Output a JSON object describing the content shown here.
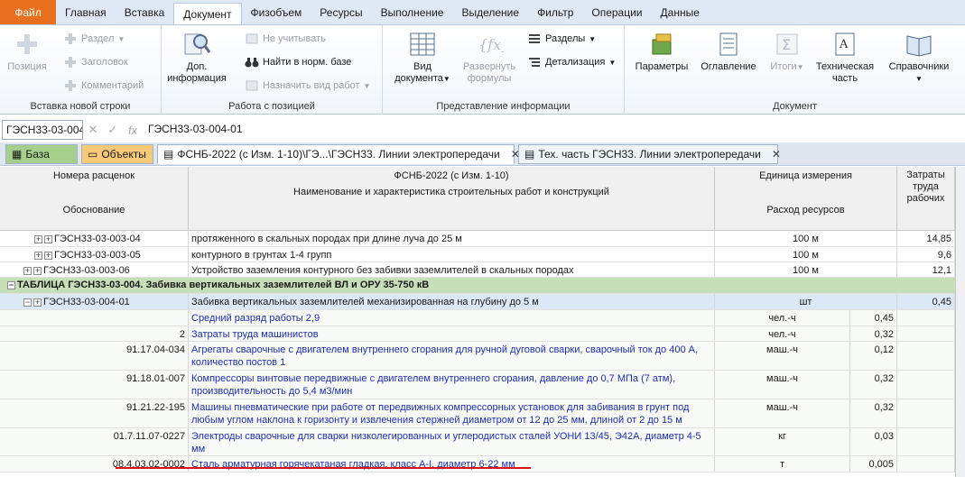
{
  "menu": {
    "file": "Файл",
    "items": [
      "Главная",
      "Вставка",
      "Документ",
      "Физобъем",
      "Ресурсы",
      "Выполнение",
      "Выделение",
      "Фильтр",
      "Операции",
      "Данные"
    ],
    "active_index": 2
  },
  "ribbon": {
    "insert_group": {
      "title": "Вставка новой строки",
      "position": "Позиция",
      "section": "Раздел",
      "heading": "Заголовок",
      "comment": "Комментарий"
    },
    "position_group": {
      "title": "Работа с позицией",
      "dop_info_1": "Доп.",
      "dop_info_2": "информация",
      "ignore": "Не учитывать",
      "find_norm": "Найти в норм. базе",
      "assign_work": "Назначить вид работ"
    },
    "view_group": {
      "title": "Представление информации",
      "doc_view_1": "Вид",
      "doc_view_2": "документа",
      "expand_1": "Развернуть",
      "expand_2": "формулы",
      "sections": "Разделы",
      "detail": "Детализация"
    },
    "document_group": {
      "title": "Документ",
      "params": "Параметры",
      "toc": "Оглавление",
      "totals": "Итоги",
      "tech_1": "Техническая",
      "tech_2": "часть",
      "refs": "Справочники"
    }
  },
  "formula_bar": {
    "cell_ref": "ГЭСН33-03-004",
    "fx": "fx",
    "value": "ГЭСН33-03-004-01"
  },
  "tabs": {
    "base": "База",
    "objects": "Объекты",
    "doc": "ФСНБ-2022 (с Изм. 1-10)\\ГЭ...\\ГЭСН33. Линии электропередачи",
    "tech": "Тех. часть ГЭСН33. Линии электропередачи"
  },
  "header": {
    "col1_top": "Номера расценок",
    "col1_bottom": "Обоснование",
    "col2_top": "ФСНБ-2022 (с Изм. 1-10)",
    "col2_mid": "Наименование и характеристика строительных работ и конструкций",
    "col3_top": "Единица измерения",
    "col3_bottom": "Расход ресурсов",
    "col4_1": "Затраты",
    "col4_2": "труда",
    "col4_3": "рабочих"
  },
  "rows": [
    {
      "code": "ГЭСН33-03-003-04",
      "name": "протяженного в скальных породах при длине луча до 25 м",
      "unit": "100 м",
      "value": "14,85"
    },
    {
      "code": "ГЭСН33-03-003-05",
      "name": "контурного в грунтах 1-4 групп",
      "unit": "100 м",
      "value": "9,6"
    },
    {
      "code": "ГЭСН33-03-003-06",
      "name": "Устройство заземления контурного без забивки заземлителей в скальных породах",
      "unit": "100 м",
      "value": "12,1"
    }
  ],
  "section": {
    "title": "ТАБЛИЦА ГЭСН33-03-004. Забивка вертикальных заземлителей ВЛ и ОРУ 35-750 кВ"
  },
  "selected_row": {
    "code": "ГЭСН33-03-004-01",
    "name": "Забивка вертикальных заземлителей механизированная на глубину до 5 м",
    "unit": "шт",
    "value": "0,45"
  },
  "resources": [
    {
      "code": "",
      "name": "Средний разряд работы 2,9",
      "unit": "чел.-ч",
      "qty": "0,45"
    },
    {
      "code": "2",
      "name": "Затраты труда машинистов",
      "unit": "чел.-ч",
      "qty": "0,32"
    },
    {
      "code": "91.17.04-034",
      "name": "Агрегаты сварочные с двигателем внутреннего сгорания для ручной дуговой сварки, сварочный ток до 400 А,",
      "name2": "количество постов 1",
      "unit": "маш.-ч",
      "qty": "0,12"
    },
    {
      "code": "91.18.01-007",
      "name": "Компрессоры винтовые передвижные с двигателем внутреннего сгорания, давление до 0,7 МПа (7 атм),",
      "name2": "производительность до 5,4 м3/мин",
      "unit": "маш.-ч",
      "qty": "0,32"
    },
    {
      "code": "91.21.22-195",
      "name": "Машины пневматические при работе от передвижных компрессорных установок для забивания в грунт под",
      "name2": "любым углом наклона к горизонту и извлечения стержней диаметром от 12 до 25 мм, длиной от 2 до 15 м",
      "unit": "маш.-ч",
      "qty": "0,32"
    },
    {
      "code": "01.7.11.07-0227",
      "name": "Электроды сварочные для сварки низколегированных и углеродистых сталей УОНИ 13/45, Э42А, диаметр 4-5",
      "name2": "мм",
      "unit": "кг",
      "qty": "0,03"
    },
    {
      "code": "08.4.03.02-0002",
      "name": "Сталь арматурная горячекатаная гладкая, класс А-I, диаметр 6-22 мм",
      "unit": "т",
      "qty": "0,005"
    }
  ]
}
